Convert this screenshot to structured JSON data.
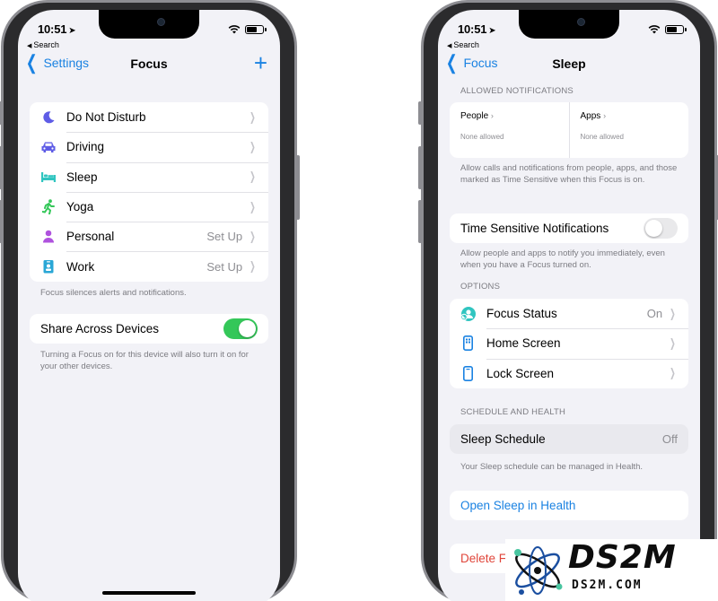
{
  "left": {
    "status": {
      "time": "10:51",
      "back_app": "Search"
    },
    "nav": {
      "back": "Settings",
      "title": "Focus"
    },
    "focus_modes": [
      {
        "icon": "moon-icon",
        "label": "Do Not Disturb",
        "value": ""
      },
      {
        "icon": "car-icon",
        "label": "Driving",
        "value": ""
      },
      {
        "icon": "bed-icon",
        "label": "Sleep",
        "value": ""
      },
      {
        "icon": "running-icon",
        "label": "Yoga",
        "value": ""
      },
      {
        "icon": "person-icon",
        "label": "Personal",
        "value": "Set Up"
      },
      {
        "icon": "badge-icon",
        "label": "Work",
        "value": "Set Up"
      }
    ],
    "modes_footer": "Focus silences alerts and notifications.",
    "share": {
      "label": "Share Across Devices",
      "on": true
    },
    "share_footer": "Turning a Focus on for this device will also turn it on for your other devices."
  },
  "right": {
    "status": {
      "time": "10:51",
      "back_app": "Search"
    },
    "nav": {
      "back": "Focus",
      "title": "Sleep"
    },
    "allowed_header": "ALLOWED NOTIFICATIONS",
    "people": {
      "label": "People",
      "sub": "None allowed"
    },
    "apps": {
      "label": "Apps",
      "sub": "None allowed"
    },
    "allowed_footer": "Allow calls and notifications from people, apps, and those marked as Time Sensitive when this Focus is on.",
    "time_sensitive": {
      "label": "Time Sensitive Notifications",
      "on": false
    },
    "time_sensitive_footer": "Allow people and apps to notify you immediately, even when you have a Focus turned on.",
    "options_header": "OPTIONS",
    "options": [
      {
        "icon": "focus-status-icon",
        "label": "Focus Status",
        "value": "On"
      },
      {
        "icon": "home-screen-icon",
        "label": "Home Screen",
        "value": ""
      },
      {
        "icon": "lock-screen-icon",
        "label": "Lock Screen",
        "value": ""
      }
    ],
    "schedule_header": "SCHEDULE AND HEALTH",
    "sleep_schedule": {
      "label": "Sleep Schedule",
      "value": "Off"
    },
    "schedule_footer": "Your Sleep schedule can be managed in Health.",
    "open_health": "Open Sleep in Health",
    "delete_partial": "Delete Fo"
  },
  "watermark": {
    "title": "DS2M",
    "subtitle": "DS2M.COM"
  },
  "colors": {
    "accent": "#1a82e2",
    "toggle_on": "#34c759",
    "danger": "#e0453a",
    "moon": "#5e5ce6",
    "driving": "#5e5ce6",
    "sleep": "#30c5c0",
    "yoga": "#34c759",
    "personal": "#af52de",
    "work": "#2aa7d6"
  }
}
